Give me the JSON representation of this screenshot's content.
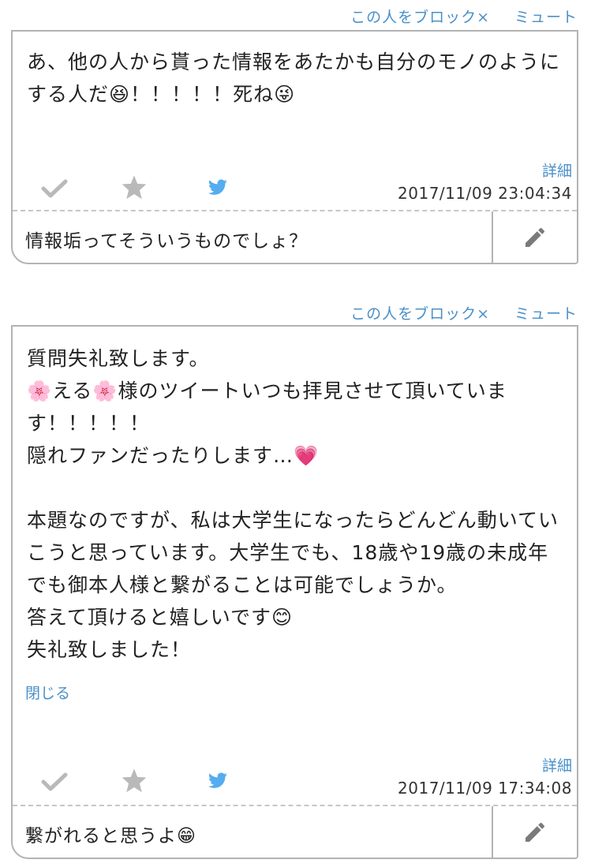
{
  "posts": [
    {
      "block_label": "この人をブロック×",
      "mute_label": "ミュート",
      "body": "あ、他の人から貰った情報をあたかも自分のモノのようにする人だ😆！！！！！死ね😜",
      "detail_label": "詳細",
      "timestamp": "2017/11/09 23:04:34",
      "reply": "情報垢ってそういうものでしょ？"
    },
    {
      "block_label": "この人をブロック×",
      "mute_label": "ミュート",
      "body": "質問失礼致します。\n🌸える🌸様のツイートいつも拝見させて頂いています！！！！！\n隠れファンだったりします…💗\n\n本題なのですが、私は大学生になったらどんどん動いていこうと思っています。大学生でも、18歳や19歳の未成年でも御本人様と繋がることは可能でしょうか。\n答えて頂けると嬉しいです😊\n失礼致しました！",
      "close_label": "閉じる",
      "detail_label": "詳細",
      "timestamp": "2017/11/09 17:34:08",
      "reply": "繋がれると思うよ😁"
    }
  ],
  "icons": [
    "check-icon",
    "star-icon",
    "twitter-icon",
    "pencil-icon"
  ],
  "colors": {
    "link": "#4a90c8",
    "border": "#b3b3b3",
    "icon_gray": "#b9b9b9"
  }
}
